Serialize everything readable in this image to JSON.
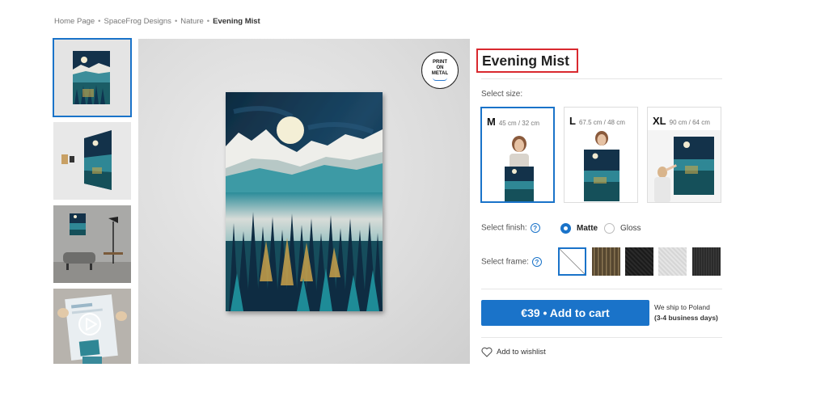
{
  "breadcrumb": {
    "items": [
      "Home Page",
      "SpaceFrog Designs",
      "Nature"
    ],
    "current": "Evening Mist",
    "separator": "•"
  },
  "preview": {
    "badge_lines": [
      "PRINT",
      "ON",
      "METAL"
    ]
  },
  "product": {
    "title": "Evening Mist"
  },
  "size": {
    "label": "Select size:",
    "options": [
      {
        "letter": "M",
        "dim": "45 cm / 32 cm",
        "selected": true
      },
      {
        "letter": "L",
        "dim": "67.5 cm / 48 cm",
        "selected": false
      },
      {
        "letter": "XL",
        "dim": "90 cm / 64 cm",
        "selected": false
      }
    ]
  },
  "finish": {
    "label": "Select finish:",
    "help": "?",
    "options": [
      {
        "label": "Matte",
        "selected": true
      },
      {
        "label": "Gloss",
        "selected": false
      }
    ]
  },
  "frame": {
    "label": "Select frame:",
    "help": "?",
    "options": [
      {
        "name": "none",
        "selected": true
      },
      {
        "name": "wood",
        "selected": false
      },
      {
        "name": "black",
        "selected": false
      },
      {
        "name": "white",
        "selected": false
      },
      {
        "name": "graphite",
        "selected": false
      }
    ]
  },
  "cart": {
    "button_label": "€39 • Add to cart",
    "ship_line1": "We ship to Poland",
    "ship_line2": "(3-4 business days)"
  },
  "wishlist": {
    "label": "Add to wishlist"
  },
  "colors": {
    "accent": "#1a73c9",
    "title_outline": "#d9292f"
  }
}
